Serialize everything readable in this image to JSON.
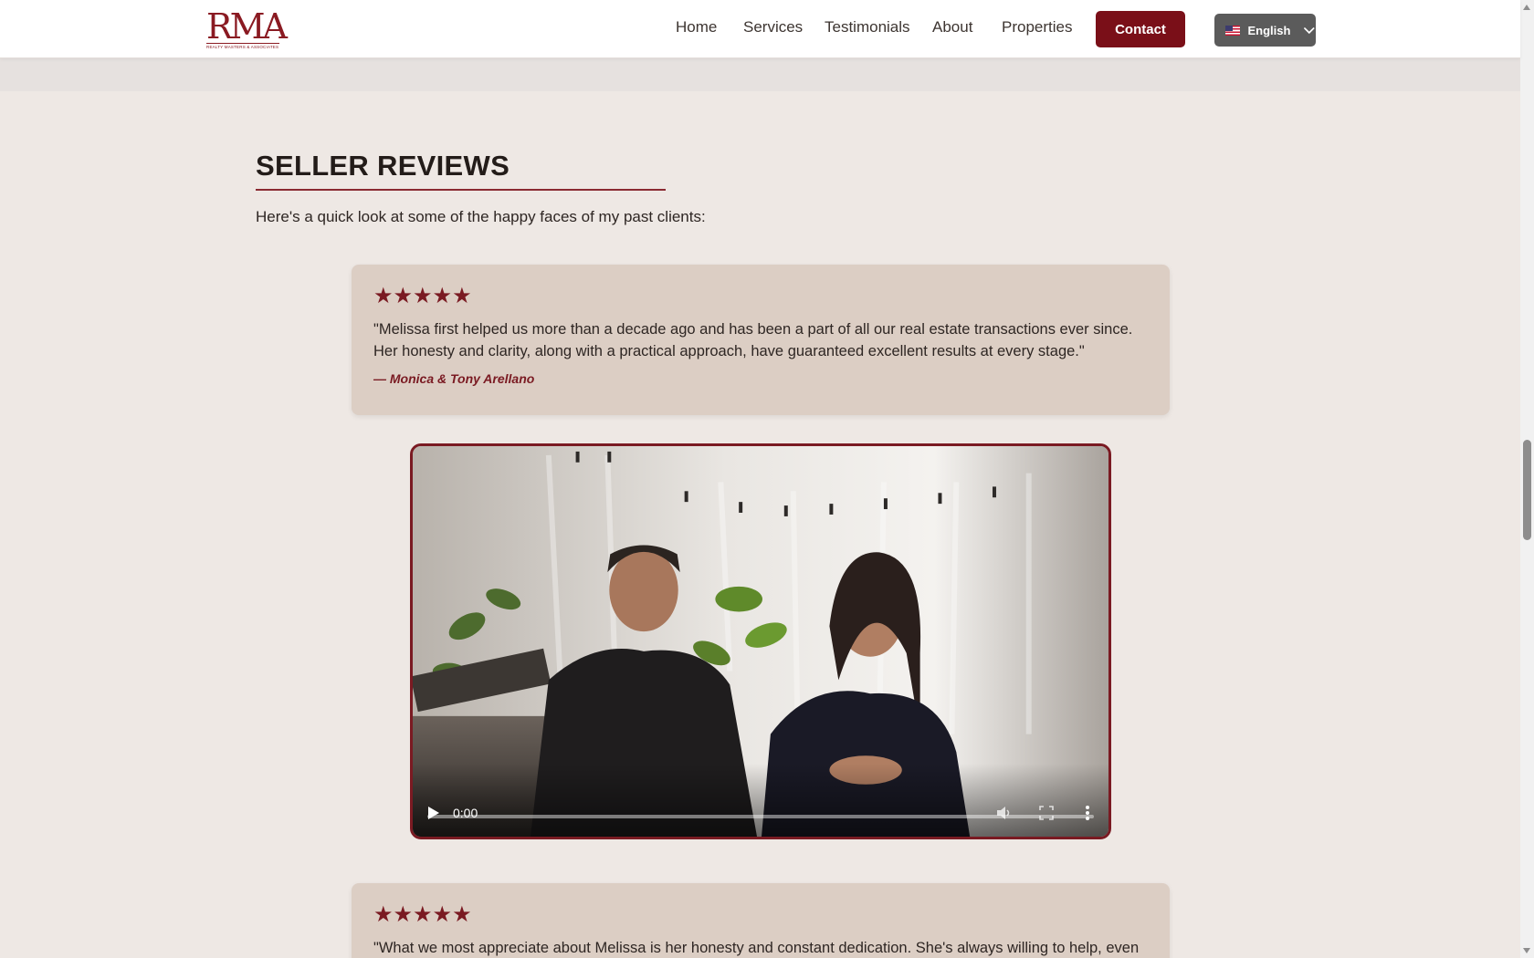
{
  "header": {
    "logo_text": "RMA",
    "logo_tagline": "REALTY MASTERS & ASSOCIATES",
    "nav": [
      "Home",
      "Services",
      "Testimonials",
      "About",
      "Properties"
    ],
    "contact_label": "Contact",
    "language_label": "English"
  },
  "section": {
    "title": "SELLER REVIEWS",
    "intro": "Here's a quick look at some of the happy faces of my past clients:"
  },
  "reviews": [
    {
      "stars": "★★★★★",
      "rating": 5,
      "quote": "\"Melissa first helped us more than a decade ago and has been a part of all our real estate transactions ever since. Her honesty and clarity, along with a practical approach, have guaranteed excellent results at every stage.\"",
      "author": "— Monica & Tony Arellano"
    },
    {
      "stars": "★★★★★",
      "rating": 5,
      "quote": "\"What we most appreciate about Melissa is her honesty and constant dedication. She's always willing to help, even"
    }
  ],
  "video": {
    "time": "0:00",
    "progress": 0
  },
  "colors": {
    "brand": "#7a0f18",
    "page_background": "#eee8e4",
    "card_background": "#dccec4"
  }
}
